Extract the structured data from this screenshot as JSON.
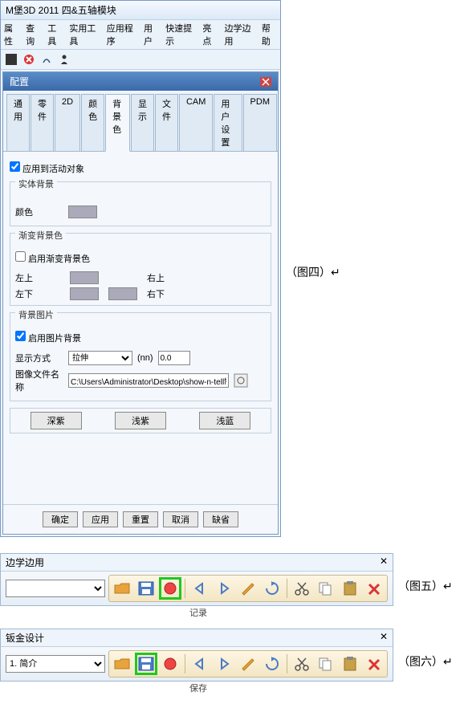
{
  "win": {
    "title": "M堡3D 2011 四&五轴模块",
    "menu": [
      "属性",
      "查询",
      "工具",
      "实用工具",
      "应用程序",
      "用户",
      "快速提示",
      "亮点",
      "边学边用",
      "帮助"
    ]
  },
  "dialog": {
    "title": "配置",
    "tabs": [
      "通用",
      "零件",
      "2D",
      "颜色",
      "背景色",
      "显示",
      "文件",
      "CAM",
      "用户设置",
      "PDM"
    ],
    "apply_active": "应用到活动对象",
    "g1": {
      "title": "实体背景",
      "color_label": "颜色"
    },
    "g2": {
      "title": "渐变背景色",
      "enable": "启用渐变背景色",
      "tl": "左上",
      "tr": "右上",
      "bl": "左下",
      "br": "右下"
    },
    "g3": {
      "title": "背景图片",
      "enable": "启用图片背景",
      "mode_label": "显示方式",
      "mode_value": "拉伸",
      "size_unit": "(nn)",
      "size_value": "0.0",
      "file_label": "图像文件名称",
      "file_value": "C:\\Users\\Administrator\\Desktop\\show-n-tell制作\\钣金"
    },
    "quick": [
      "深紫",
      "浅紫",
      "浅蓝"
    ],
    "buttons": [
      "确定",
      "应用",
      "重置",
      "取消",
      "缺省"
    ]
  },
  "fig4": "（图四）",
  "panel5": {
    "title": "边学边用",
    "drop": "",
    "annot": "记录"
  },
  "fig5": "（图五）",
  "panel6": {
    "title": "钣金设计",
    "drop": "1. 简介",
    "annot": "保存"
  },
  "fig6": "（图六）",
  "arrow": "↵"
}
